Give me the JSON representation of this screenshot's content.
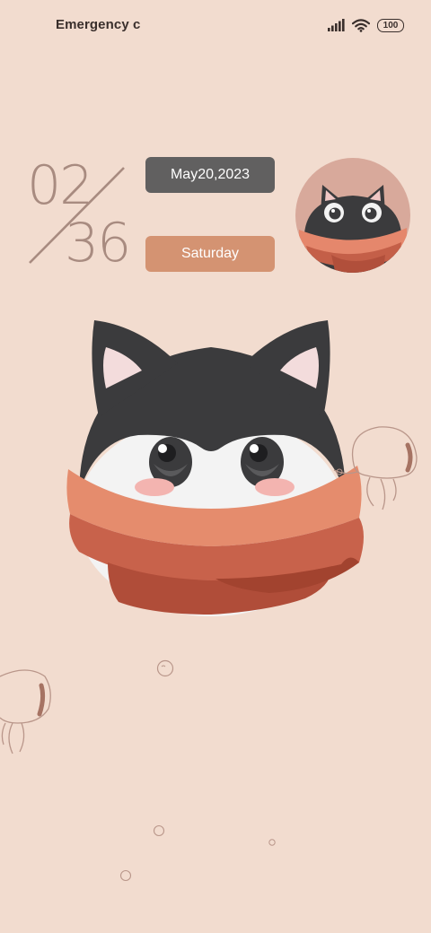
{
  "status_bar": {
    "carrier": "Emergency c",
    "signal_icon": "cellular-signal-icon",
    "wifi_icon": "wifi-icon",
    "battery": "100"
  },
  "clock": {
    "hour": "02",
    "minute": "36"
  },
  "date": "May20,2023",
  "weekday": "Saturday",
  "colors": {
    "background": "#f2dccf",
    "date_pill": "#616060",
    "weekday_pill": "#d49372",
    "clock_digits": "#a88b80"
  }
}
